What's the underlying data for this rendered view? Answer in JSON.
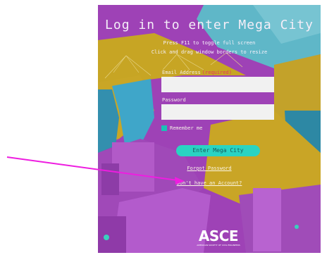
{
  "dialog": {
    "title": "Log in to enter Mega City",
    "hint_fullscreen": "Press F11 to toggle full screen",
    "hint_resize": "Click and drag window borders to resize"
  },
  "form": {
    "email_label": "Email Address",
    "email_required": "(required)",
    "email_value": "",
    "password_label": "Password",
    "password_value": "",
    "remember_label": "Remember me",
    "remember_checked": true,
    "submit_label": "Enter Mega City",
    "forgot_link": "Forgot Password",
    "signup_link": "Don't have an Account?"
  },
  "branding": {
    "logo_text": "ASCE",
    "logo_subtitle": "AMERICAN SOCIETY OF CIVIL ENGINEERS"
  },
  "colors": {
    "accent": "#2ad3c2",
    "required": "#e6355c",
    "annotation_arrow": "#ee1de0"
  }
}
